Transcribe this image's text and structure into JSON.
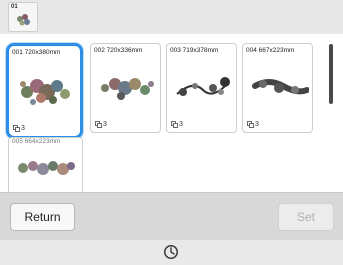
{
  "category": {
    "number": "01",
    "icon": "floral-design-thumbnail"
  },
  "designs": [
    {
      "label": "001 720x380mm",
      "count": "3",
      "selected": true
    },
    {
      "label": "002 720x336mm",
      "count": "3",
      "selected": false
    },
    {
      "label": "003 719x378mm",
      "count": "3",
      "selected": false
    },
    {
      "label": "004 667x223mm",
      "count": "3",
      "selected": false
    },
    {
      "label": "005 664x223mm",
      "count": "",
      "selected": false
    }
  ],
  "buttons": {
    "return_label": "Return",
    "set_label": "Set"
  },
  "footer": {
    "icon": "clock-icon"
  },
  "colors": {
    "selection": "#2d8ee6",
    "background": "#e4e4e4"
  }
}
